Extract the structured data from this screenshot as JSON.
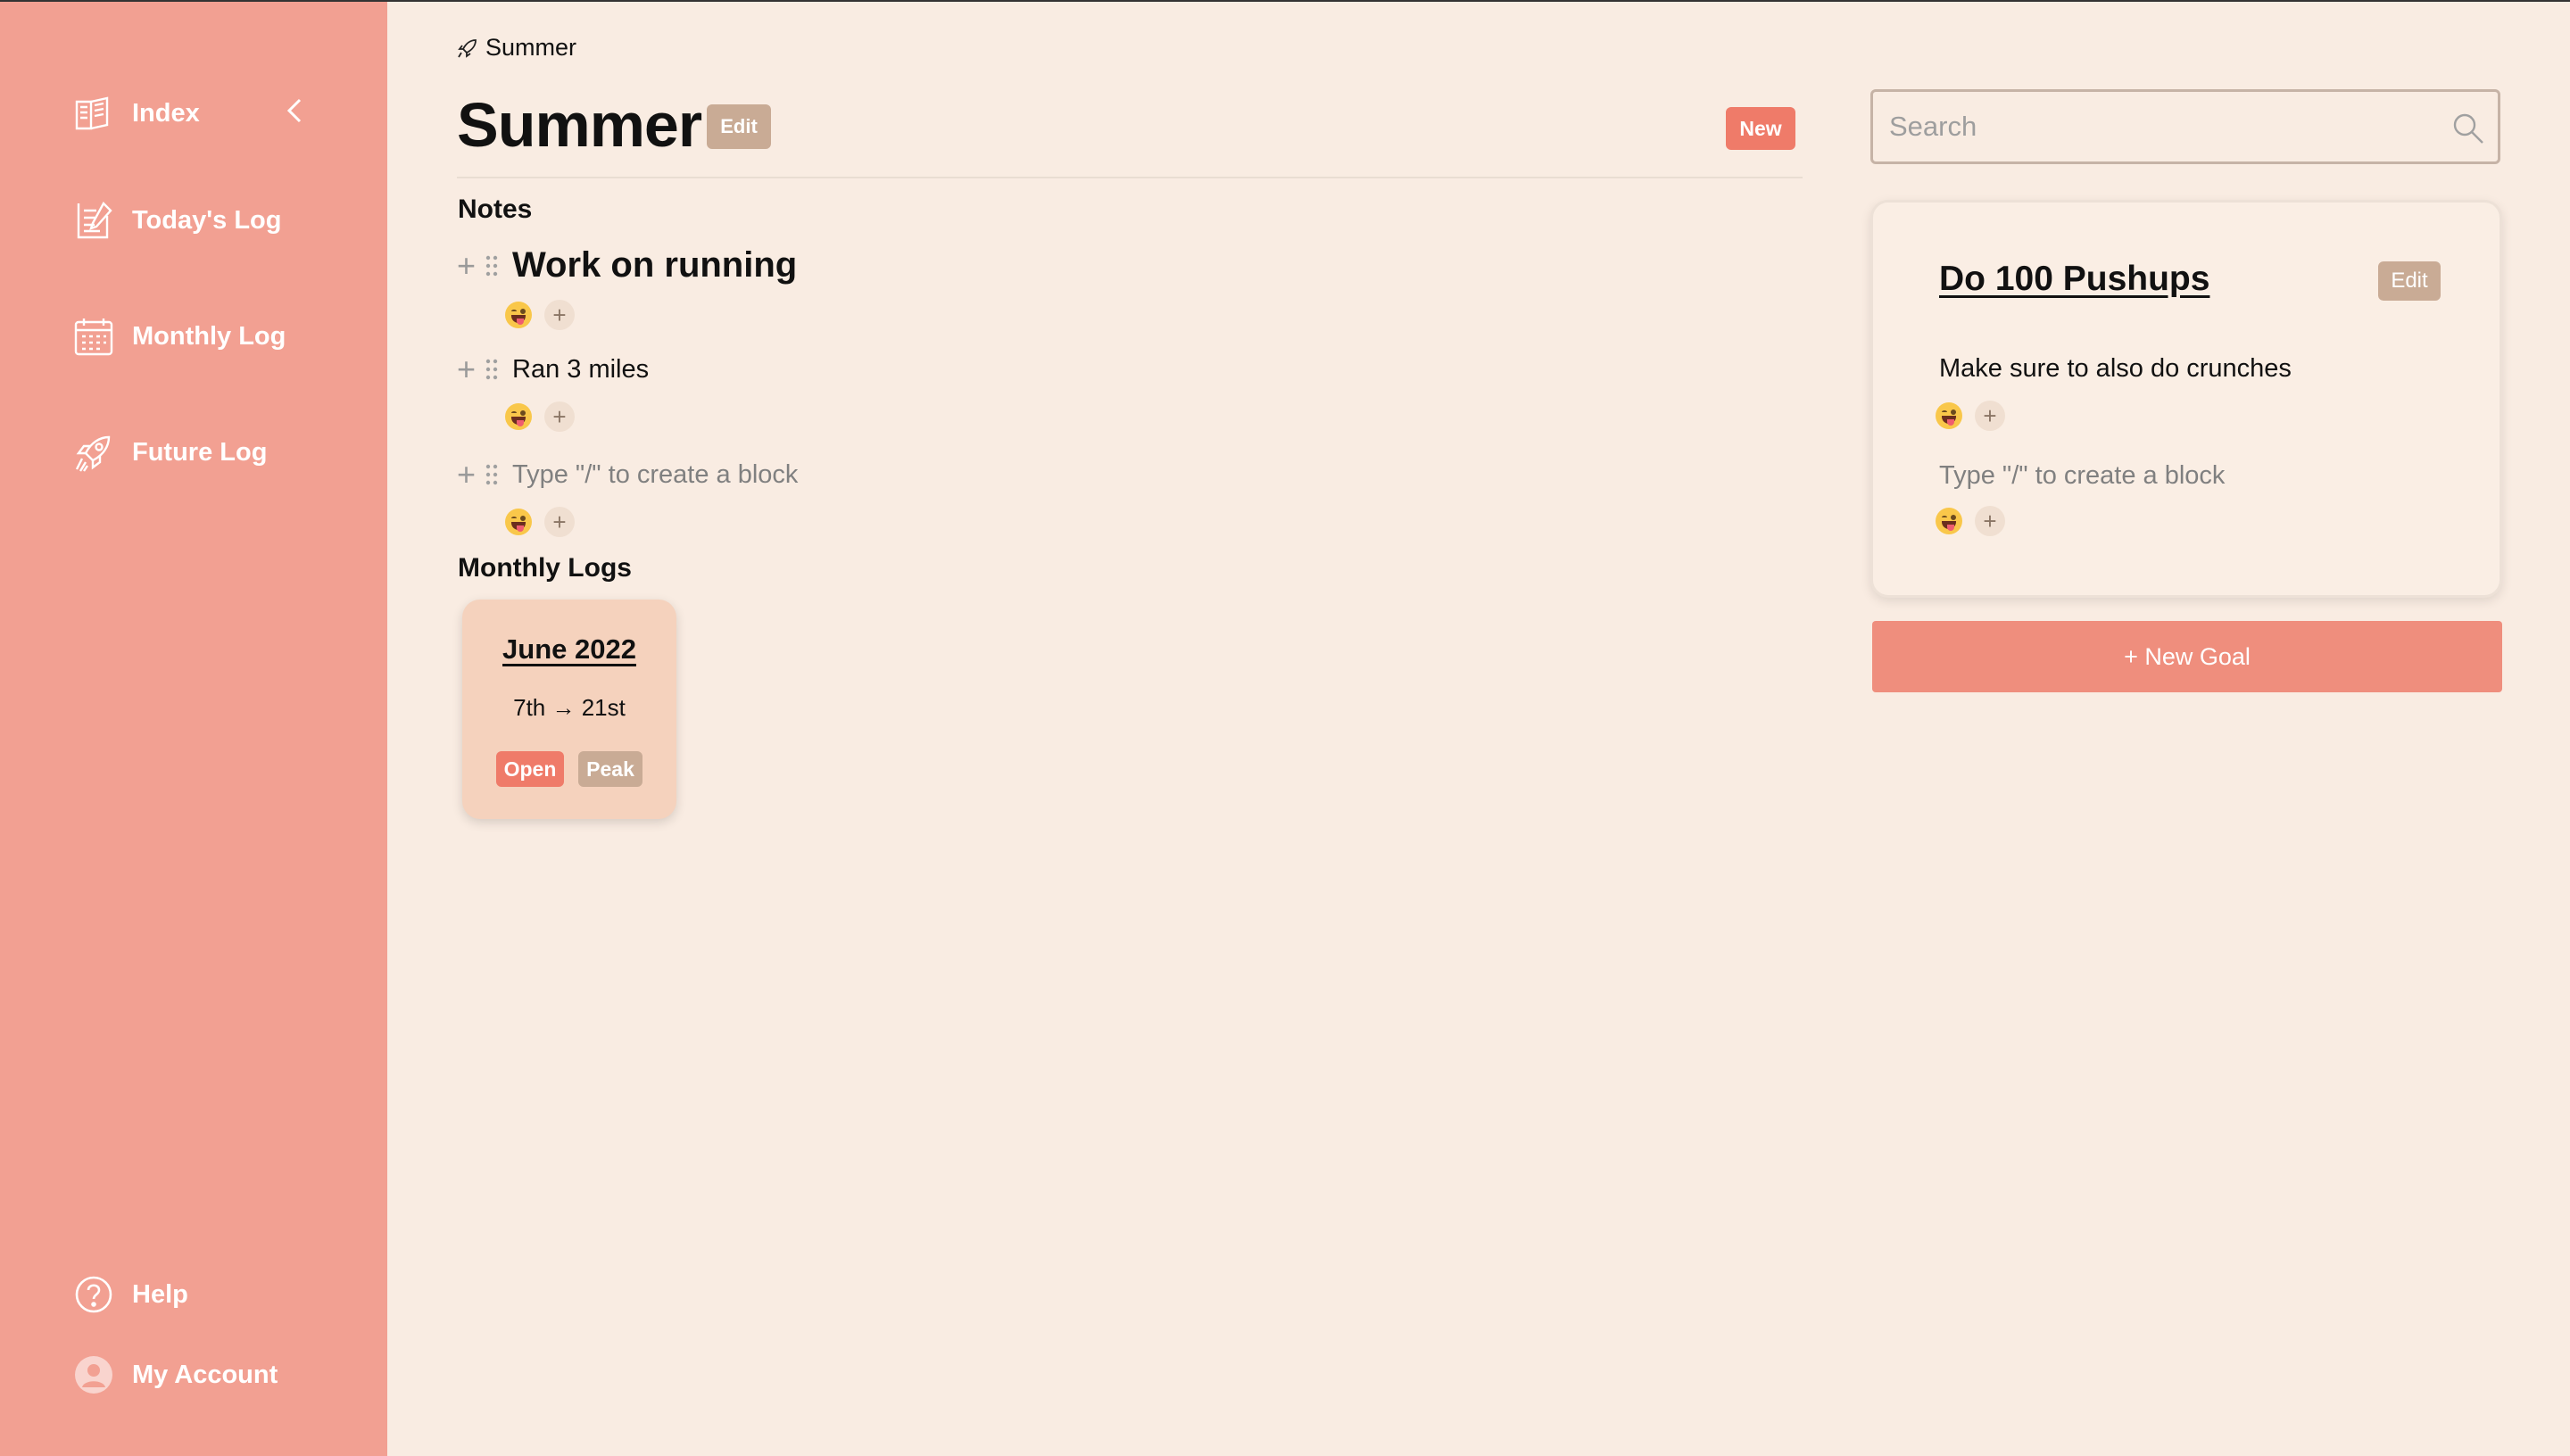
{
  "sidebar": {
    "items": [
      {
        "label": "Index",
        "icon": "book-icon"
      },
      {
        "label": "Today's Log",
        "icon": "checklist-icon"
      },
      {
        "label": "Monthly Log",
        "icon": "calendar-icon"
      },
      {
        "label": "Future Log",
        "icon": "rocket-icon"
      }
    ],
    "bottom": [
      {
        "label": "Help",
        "icon": "help-icon"
      },
      {
        "label": "My Account",
        "icon": "account-icon"
      }
    ],
    "collapse_icon": "chevron-left-icon"
  },
  "breadcrumb": {
    "text": "Summer",
    "icon": "rocket-icon"
  },
  "page": {
    "title": "Summer",
    "edit_label": "Edit",
    "new_label": "New"
  },
  "notes": {
    "title": "Notes",
    "blocks": [
      {
        "text": "Work on running",
        "style": "heading"
      },
      {
        "text": "Ran 3 miles",
        "style": "text"
      },
      {
        "text": "Type \"/\" to create a block",
        "style": "placeholder"
      }
    ],
    "reaction_add": "+"
  },
  "monthly_logs": {
    "title": "Monthly Logs",
    "cards": [
      {
        "title": "June 2022",
        "range": "7th → 21st",
        "open_label": "Open",
        "peak_label": "Peak"
      }
    ]
  },
  "search": {
    "placeholder": "Search",
    "value": ""
  },
  "goal": {
    "title": "Do 100 Pushups",
    "edit_label": "Edit",
    "text": "Make sure to also do crunches",
    "placeholder": "Type \"/\" to create a block",
    "reaction_add": "+"
  },
  "new_goal_label": "+ New Goal",
  "colors": {
    "sidebar": "#f2a092",
    "background": "#f9ece2",
    "accent": "#ef7b69",
    "tag_muted": "#c9ab95",
    "card": "#f5d2bd"
  }
}
